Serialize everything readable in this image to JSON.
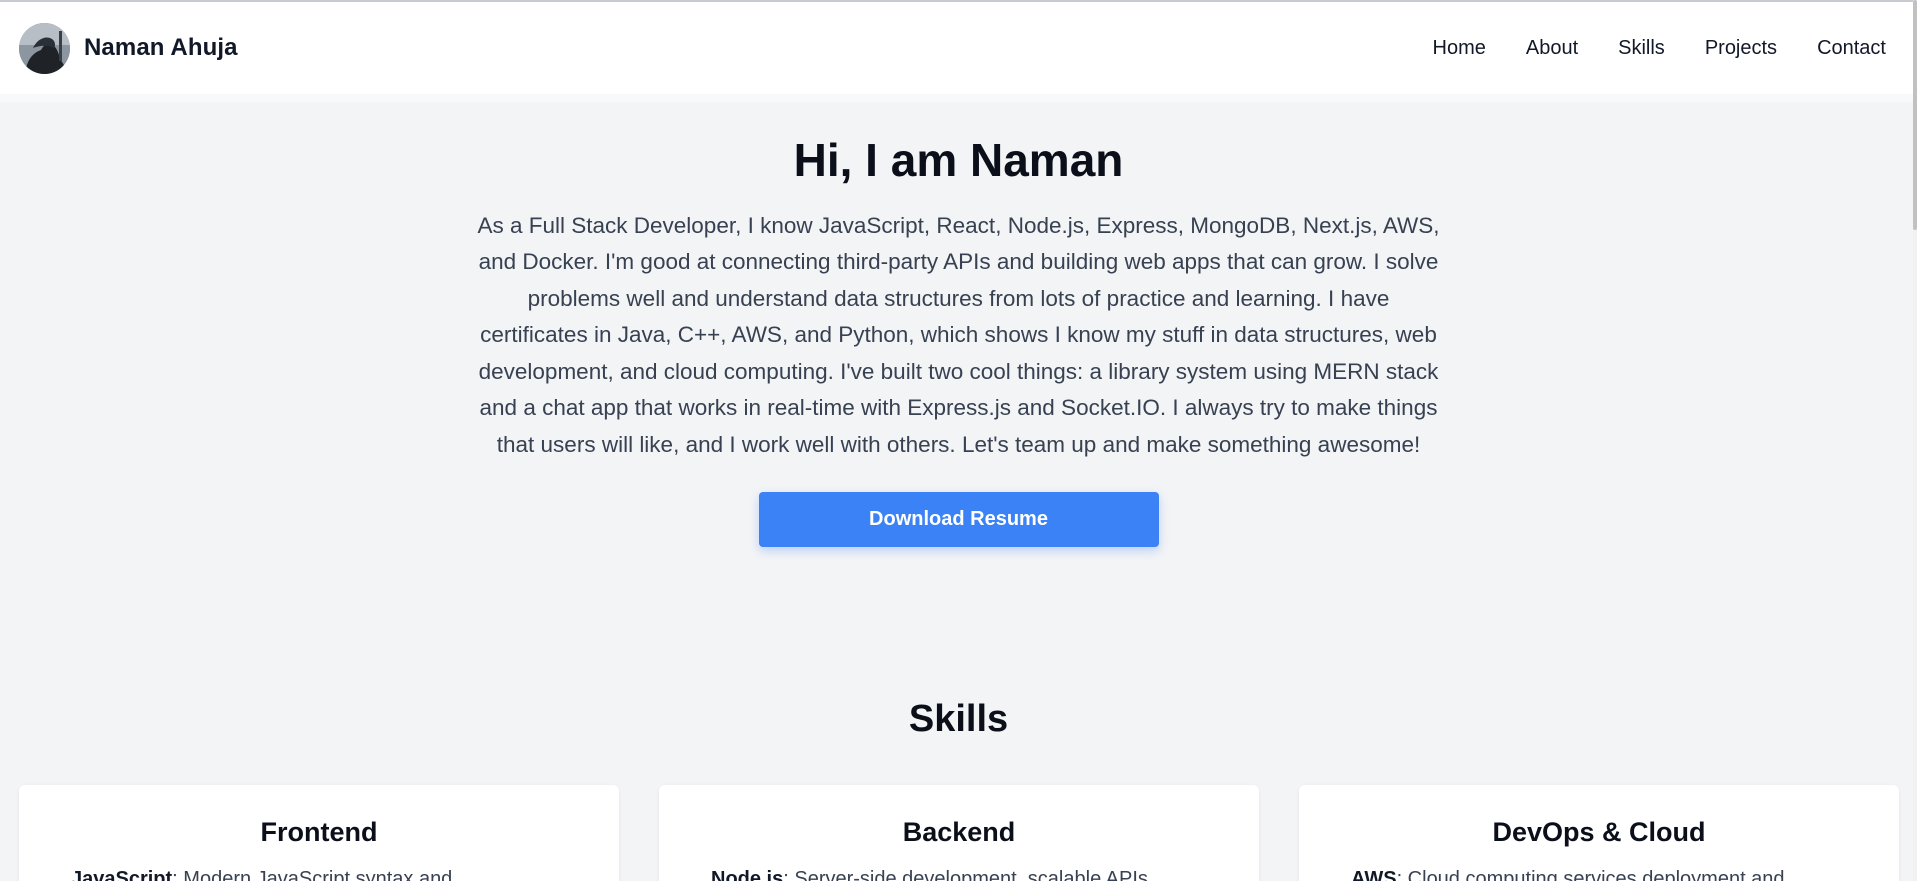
{
  "header": {
    "brand_name": "Naman Ahuja",
    "nav": [
      "Home",
      "About",
      "Skills",
      "Projects",
      "Contact"
    ]
  },
  "hero": {
    "title": "Hi, I am Naman",
    "bio": "As a Full Stack Developer, I know JavaScript, React, Node.js, Express, MongoDB, Next.js, AWS, and Docker. I'm good at connecting third-party APIs and building web apps that can grow. I solve problems well and understand data structures from lots of practice and learning. I have certificates in Java, C++, AWS, and Python, which shows I know my stuff in data structures, web development, and cloud computing. I've built two cool things: a library system using MERN stack and a chat app that works in real-time with Express.js and Socket.IO. I always try to make things that users will like, and I work well with others. Let's team up and make something awesome!",
    "cta_label": "Download Resume"
  },
  "skills": {
    "title": "Skills",
    "cards": [
      {
        "title": "Frontend",
        "first_key": "JavaScript",
        "first_text": ": Modern JavaScript syntax and"
      },
      {
        "title": "Backend",
        "first_key": "Node.js",
        "first_text": ": Server-side development, scalable APIs"
      },
      {
        "title": "DevOps & Cloud",
        "first_key": "AWS",
        "first_text": ": Cloud computing services deployment and"
      }
    ]
  },
  "colors": {
    "accent": "#3b82f6",
    "background": "#f3f4f6",
    "text": "#111827"
  }
}
